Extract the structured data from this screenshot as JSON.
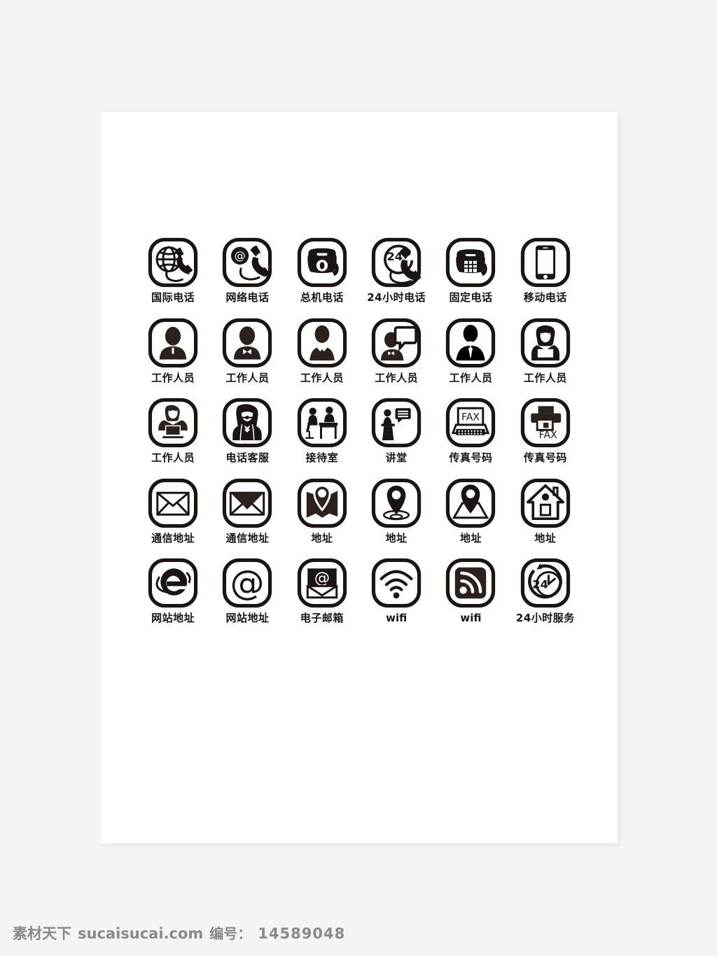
{
  "page": {
    "background_color": "#f4f4f4",
    "artboard_color": "#ffffff",
    "icon_color": "#1a1412"
  },
  "icon_set": {
    "columns": 6,
    "rows": 5,
    "items": [
      {
        "icon": "globe-phone-icon",
        "label": "国际电话",
        "row": 1,
        "col": 1
      },
      {
        "icon": "at-handset-icon",
        "label": "网络电话",
        "row": 1,
        "col": 2
      },
      {
        "icon": "rotary-phone-icon",
        "label": "总机电话",
        "row": 1,
        "col": 3
      },
      {
        "icon": "24h-handset-icon",
        "label": "24小时电话",
        "row": 1,
        "col": 4
      },
      {
        "icon": "landline-phone-icon",
        "label": "固定电话",
        "row": 1,
        "col": 5
      },
      {
        "icon": "mobile-phone-icon",
        "label": "移动电话",
        "row": 1,
        "col": 6
      },
      {
        "icon": "person-bust-icon",
        "label": "工作人员",
        "row": 2,
        "col": 1
      },
      {
        "icon": "person-bowtie-icon",
        "label": "工作人员",
        "row": 2,
        "col": 2
      },
      {
        "icon": "person-suit-tie-icon",
        "label": "工作人员",
        "row": 2,
        "col": 3
      },
      {
        "icon": "person-speech-icon",
        "label": "工作人员",
        "row": 2,
        "col": 4
      },
      {
        "icon": "person-necktie-icon",
        "label": "工作人员",
        "row": 2,
        "col": 5
      },
      {
        "icon": "woman-worker-icon",
        "label": "工作人员",
        "row": 2,
        "col": 6
      },
      {
        "icon": "person-laptop-icon",
        "label": "工作人员",
        "row": 3,
        "col": 1
      },
      {
        "icon": "headset-woman-icon",
        "label": "电话客服",
        "row": 3,
        "col": 2
      },
      {
        "icon": "reception-desk-icon",
        "label": "接待室",
        "row": 3,
        "col": 3
      },
      {
        "icon": "lecture-podium-icon",
        "label": "讲堂",
        "row": 3,
        "col": 4
      },
      {
        "icon": "fax-machine-icon",
        "label": "传真号码",
        "row": 3,
        "col": 5
      },
      {
        "icon": "fax-printer-icon",
        "label": "传真号码",
        "row": 3,
        "col": 6
      },
      {
        "icon": "envelope-outline-icon",
        "label": "通信地址",
        "row": 4,
        "col": 1
      },
      {
        "icon": "envelope-filled-icon",
        "label": "通信地址",
        "row": 4,
        "col": 2
      },
      {
        "icon": "map-pin-fold-icon",
        "label": "地址",
        "row": 4,
        "col": 3
      },
      {
        "icon": "map-pin-ripple-icon",
        "label": "地址",
        "row": 4,
        "col": 4
      },
      {
        "icon": "map-pin-plane-icon",
        "label": "地址",
        "row": 4,
        "col": 5
      },
      {
        "icon": "house-icon",
        "label": "地址",
        "row": 4,
        "col": 6
      },
      {
        "icon": "ie-browser-icon",
        "label": "网站地址",
        "row": 5,
        "col": 1
      },
      {
        "icon": "at-sign-icon",
        "label": "网站地址",
        "row": 5,
        "col": 2
      },
      {
        "icon": "email-envelope-at-icon",
        "label": "电子邮箱",
        "row": 5,
        "col": 3
      },
      {
        "icon": "wifi-waves-icon",
        "label": "wifi",
        "row": 5,
        "col": 4
      },
      {
        "icon": "wifi-rss-square-icon",
        "label": "wifi",
        "row": 5,
        "col": 5
      },
      {
        "icon": "24h-clock-icon",
        "label": "24小时服务",
        "row": 5,
        "col": 6
      }
    ]
  },
  "watermark": {
    "brand": "素材天下",
    "site": "sucaisucai.com",
    "number_label": "编号：",
    "number": "14589048"
  }
}
